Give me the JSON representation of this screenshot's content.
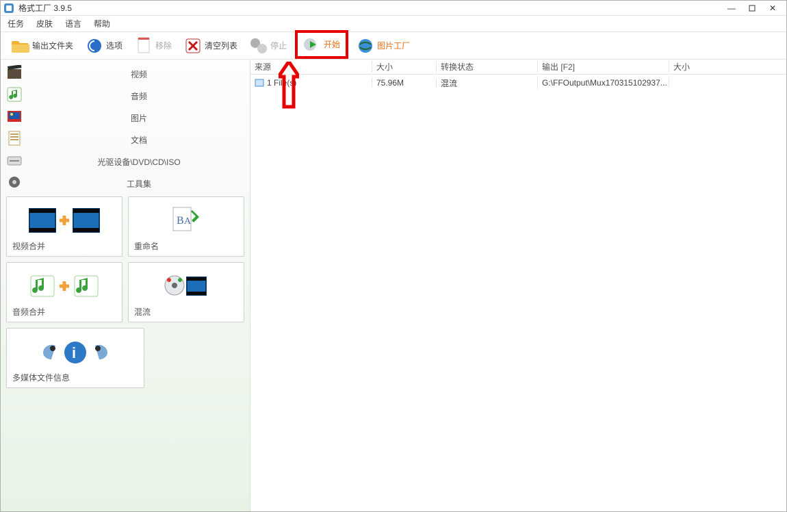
{
  "title": "格式工厂 3.9.5",
  "menu": {
    "task": "任务",
    "skin": "皮肤",
    "language": "语言",
    "help": "帮助"
  },
  "toolbar": {
    "output_folder": "输出文件夹",
    "options": "选项",
    "remove": "移除",
    "clear": "清空列表",
    "stop": "停止",
    "start": "开始",
    "photo_factory": "图片工厂"
  },
  "sidebar": {
    "categories": {
      "video": "视频",
      "audio": "音频",
      "image": "图片",
      "document": "文档",
      "disc": "光驱设备\\DVD\\CD\\ISO",
      "tools": "工具集"
    },
    "cards": {
      "video_join": "视频合并",
      "rename": "重命名",
      "audio_join": "音频合并",
      "mux": "混流",
      "media_info": "多媒体文件信息"
    }
  },
  "tasks": {
    "headers": {
      "source": "来源",
      "size": "大小",
      "state": "转换状态",
      "output": "输出 [F2]",
      "size2": "大小"
    },
    "row": {
      "source": "1 File(s)",
      "size": "75.96M",
      "state": "混流",
      "output": "G:\\FFOutput\\Mux170315102937...",
      "size2": ""
    }
  }
}
